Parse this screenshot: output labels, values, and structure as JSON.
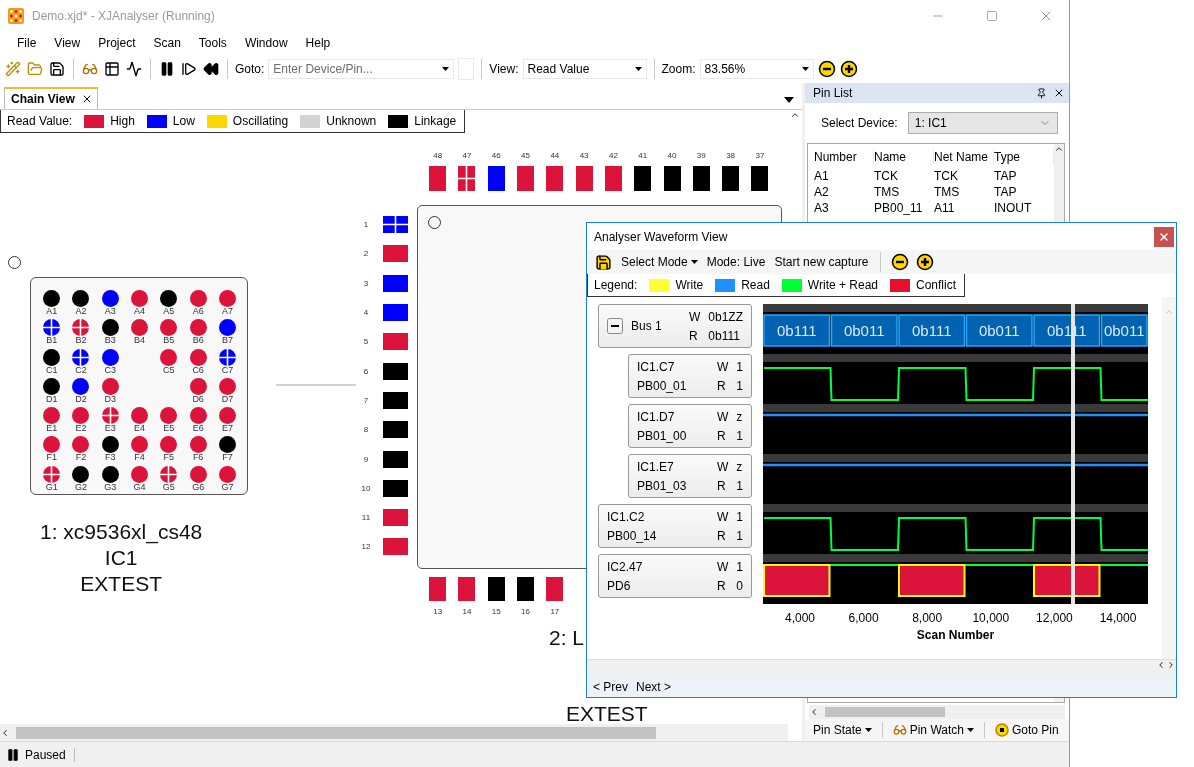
{
  "window": {
    "title": "Demo.xjd* - XJAnalyser (Running)"
  },
  "menu": [
    "File",
    "View",
    "Project",
    "Scan",
    "Tools",
    "Window",
    "Help"
  ],
  "toolbar": {
    "goto": {
      "label": "Goto:",
      "placeholder": "Enter Device/Pin..."
    },
    "view": {
      "label": "View:",
      "value": "Read Value"
    },
    "zoom": {
      "label": "Zoom:",
      "value": "83.56%"
    }
  },
  "chain_view": {
    "tab": {
      "label": "Chain View",
      "selected": true
    },
    "legend": {
      "label": "Read Value:",
      "items": [
        {
          "label": "High",
          "color": "#dc143c"
        },
        {
          "label": "Low",
          "color": "#0000ff"
        },
        {
          "label": "Oscillating",
          "color": "#ffd700"
        },
        {
          "label": "Unknown",
          "color": "#d3d3d3"
        },
        {
          "label": "Linkage",
          "color": "#000000"
        }
      ]
    },
    "bga": {
      "caption": [
        "1: xc9536xl_cs48",
        "IC1",
        "EXTEST"
      ],
      "rows": [
        [
          {
            "kind": "pin",
            "label": "A1",
            "color": "#000000",
            "marked": false
          },
          {
            "kind": "pin",
            "label": "A2",
            "color": "#000000",
            "marked": false
          },
          {
            "kind": "pin",
            "label": "A3",
            "color": "#0000ff",
            "marked": false
          },
          {
            "kind": "pin",
            "label": "A4",
            "color": "#dc143c",
            "marked": false
          },
          {
            "kind": "pin",
            "label": "A5",
            "color": "#000000",
            "marked": false
          },
          {
            "kind": "pin",
            "label": "A6",
            "color": "#dc143c",
            "marked": false
          },
          {
            "kind": "pin",
            "label": "A7",
            "color": "#dc143c",
            "marked": false
          }
        ],
        [
          {
            "kind": "pin",
            "label": "B1",
            "color": "#0000ff",
            "marked": true
          },
          {
            "kind": "pin",
            "label": "B2",
            "color": "#dc143c",
            "marked": true
          },
          {
            "kind": "pin",
            "label": "B3",
            "color": "#000000",
            "marked": false
          },
          {
            "kind": "pin",
            "label": "B4",
            "color": "#dc143c",
            "marked": false
          },
          {
            "kind": "pin",
            "label": "B5",
            "color": "#dc143c",
            "marked": false
          },
          {
            "kind": "pin",
            "label": "B6",
            "color": "#dc143c",
            "marked": false
          },
          {
            "kind": "pin",
            "label": "B7",
            "color": "#0000ff",
            "marked": false
          }
        ],
        [
          {
            "kind": "pin",
            "label": "C1",
            "color": "#000000",
            "marked": false
          },
          {
            "kind": "pin",
            "label": "C2",
            "color": "#0000ff",
            "marked": true
          },
          {
            "kind": "pin",
            "label": "C3",
            "color": "#0000ff",
            "marked": false
          },
          {
            "kind": "gap"
          },
          {
            "kind": "pin",
            "label": "C5",
            "color": "#dc143c",
            "marked": false
          },
          {
            "kind": "pin",
            "label": "C6",
            "color": "#dc143c",
            "marked": false
          },
          {
            "kind": "pin",
            "label": "C7",
            "color": "#0000ff",
            "marked": true
          }
        ],
        [
          {
            "kind": "pin",
            "label": "D1",
            "color": "#000000",
            "marked": false
          },
          {
            "kind": "pin",
            "label": "D2",
            "color": "#0000ff",
            "marked": false
          },
          {
            "kind": "pin",
            "label": "D3",
            "color": "#dc143c",
            "marked": false
          },
          {
            "kind": "gap"
          },
          {
            "kind": "gap"
          },
          {
            "kind": "pin",
            "label": "D6",
            "color": "#dc143c",
            "marked": false
          },
          {
            "kind": "pin",
            "label": "D7",
            "color": "#dc143c",
            "marked": false
          }
        ],
        [
          {
            "kind": "pin",
            "label": "E1",
            "color": "#dc143c",
            "marked": false
          },
          {
            "kind": "pin",
            "label": "E2",
            "color": "#dc143c",
            "marked": false
          },
          {
            "kind": "pin",
            "label": "E3",
            "color": "#dc143c",
            "marked": true
          },
          {
            "kind": "pin",
            "label": "E4",
            "color": "#dc143c",
            "marked": false
          },
          {
            "kind": "pin",
            "label": "E5",
            "color": "#dc143c",
            "marked": false
          },
          {
            "kind": "pin",
            "label": "E6",
            "color": "#dc143c",
            "marked": false
          },
          {
            "kind": "pin",
            "label": "E7",
            "color": "#dc143c",
            "marked": false
          }
        ],
        [
          {
            "kind": "pin",
            "label": "F1",
            "color": "#dc143c",
            "marked": false
          },
          {
            "kind": "pin",
            "label": "F2",
            "color": "#dc143c",
            "marked": false
          },
          {
            "kind": "pin",
            "label": "F3",
            "color": "#000000",
            "marked": false
          },
          {
            "kind": "pin",
            "label": "F4",
            "color": "#dc143c",
            "marked": false
          },
          {
            "kind": "pin",
            "label": "F5",
            "color": "#dc143c",
            "marked": false
          },
          {
            "kind": "pin",
            "label": "F6",
            "color": "#dc143c",
            "marked": false
          },
          {
            "kind": "pin",
            "label": "F7",
            "color": "#000000",
            "marked": false
          }
        ],
        [
          {
            "kind": "pin",
            "label": "G1",
            "color": "#dc143c",
            "marked": true
          },
          {
            "kind": "pin",
            "label": "G2",
            "color": "#000000",
            "marked": false
          },
          {
            "kind": "pin",
            "label": "G3",
            "color": "#000000",
            "marked": false
          },
          {
            "kind": "pin",
            "label": "G4",
            "color": "#dc143c",
            "marked": false
          },
          {
            "kind": "pin",
            "label": "G5",
            "color": "#dc143c",
            "marked": true
          },
          {
            "kind": "pin",
            "label": "G6",
            "color": "#dc143c",
            "marked": false
          },
          {
            "kind": "pin",
            "label": "G7",
            "color": "#dc143c",
            "marked": false
          }
        ]
      ]
    },
    "qfp": {
      "caption": [
        "2: L",
        "EXTEST"
      ],
      "top_pins": [
        {
          "label": "48",
          "color": "#dc143c",
          "marked": false
        },
        {
          "label": "47",
          "color": "#dc143c",
          "marked": true
        },
        {
          "label": "46",
          "color": "#0000ff",
          "marked": false
        },
        {
          "label": "45",
          "color": "#dc143c",
          "marked": false
        },
        {
          "label": "44",
          "color": "#dc143c",
          "marked": false
        },
        {
          "label": "43",
          "color": "#dc143c",
          "marked": false
        },
        {
          "label": "42",
          "color": "#dc143c",
          "marked": false
        },
        {
          "label": "41",
          "color": "#000000",
          "marked": false
        },
        {
          "label": "40",
          "color": "#000000",
          "marked": false
        },
        {
          "label": "39",
          "color": "#000000",
          "marked": false
        },
        {
          "label": "38",
          "color": "#000000",
          "marked": false
        },
        {
          "label": "37",
          "color": "#000000",
          "marked": false
        }
      ],
      "left_pins": [
        {
          "label": "1",
          "color": "#0000ff",
          "marked": true
        },
        {
          "label": "2",
          "color": "#dc143c",
          "marked": false
        },
        {
          "label": "3",
          "color": "#0000ff",
          "marked": false
        },
        {
          "label": "4",
          "color": "#0000ff",
          "marked": false
        },
        {
          "label": "5",
          "color": "#dc143c",
          "marked": false
        },
        {
          "label": "6",
          "color": "#000000",
          "marked": false
        },
        {
          "label": "7",
          "color": "#000000",
          "marked": false
        },
        {
          "label": "8",
          "color": "#000000",
          "marked": false
        },
        {
          "label": "9",
          "color": "#000000",
          "marked": false
        },
        {
          "label": "10",
          "color": "#000000",
          "marked": false
        },
        {
          "label": "11",
          "color": "#dc143c",
          "marked": false
        },
        {
          "label": "12",
          "color": "#dc143c",
          "marked": false
        }
      ],
      "bottom_pins": [
        {
          "label": "13",
          "color": "#dc143c",
          "marked": false
        },
        {
          "label": "14",
          "color": "#dc143c",
          "marked": false
        },
        {
          "label": "15",
          "color": "#000000",
          "marked": false
        },
        {
          "label": "16",
          "color": "#000000",
          "marked": false
        },
        {
          "label": "17",
          "color": "#dc143c",
          "marked": false
        }
      ]
    }
  },
  "pin_list": {
    "title": "Pin List",
    "device_label": "Select Device:",
    "device": "1: IC1",
    "columns": [
      "Number",
      "Name",
      "Net Name",
      "Type"
    ],
    "rows": [
      [
        "A1",
        "TCK",
        "TCK",
        "TAP"
      ],
      [
        "A2",
        "TMS",
        "TMS",
        "TAP"
      ],
      [
        "A3",
        "PB00_11",
        "A11",
        "INOUT"
      ]
    ],
    "tools": [
      {
        "kind": "dropdown",
        "label": "Pin State"
      },
      {
        "kind": "watch",
        "label": "Pin Watch"
      },
      {
        "kind": "goto",
        "label": "Goto Pin"
      }
    ]
  },
  "waveform": {
    "title": "Analyser Waveform View",
    "toolbar": {
      "mode_menu": "Select Mode",
      "mode": "Mode: Live",
      "capture": "Start new capture"
    },
    "legend": {
      "label": "Legend:",
      "items": [
        {
          "label": "Write",
          "color": "#ffff33"
        },
        {
          "label": "Read",
          "color": "#1e90ff"
        },
        {
          "label": "Write + Read",
          "color": "#00ff33"
        },
        {
          "label": "Conflict",
          "color": "#e8102e"
        }
      ]
    },
    "signals": [
      {
        "kind": "bus",
        "name": "Bus 1",
        "w_label": "W",
        "write": "0b1ZZ",
        "r_label": "R",
        "read": "0b111",
        "expanded": true,
        "values": [
          "0b111",
          "0b011",
          "0b111",
          "0b011",
          "0b111",
          "0b011"
        ],
        "children": [
          {
            "kind": "square",
            "name": "IC1.C7",
            "net": "PB00_01",
            "w_label": "W",
            "write": "1",
            "r_label": "R",
            "read": "1"
          },
          {
            "kind": "read",
            "name": "IC1.D7",
            "net": "PB01_00",
            "w_label": "W",
            "write": "z",
            "r_label": "R",
            "read": "1"
          },
          {
            "kind": "read",
            "name": "IC1.E7",
            "net": "PB01_03",
            "w_label": "W",
            "write": "z",
            "r_label": "R",
            "read": "1"
          }
        ]
      },
      {
        "kind": "square",
        "name": "IC1.C2",
        "net": "PB00_14",
        "w_label": "W",
        "write": "1",
        "r_label": "R",
        "read": "1"
      },
      {
        "kind": "conflict",
        "name": "IC2.47",
        "net": "PD6",
        "w_label": "W",
        "write": "1",
        "r_label": "R",
        "read": "0"
      }
    ],
    "axis": {
      "ticks": [
        "4,000",
        "6,000",
        "8,000",
        "10,000",
        "12,000",
        "14,000"
      ],
      "label": "Scan Number"
    },
    "nav": [
      "< Prev",
      "Next >"
    ]
  },
  "status": {
    "text": "Paused"
  }
}
